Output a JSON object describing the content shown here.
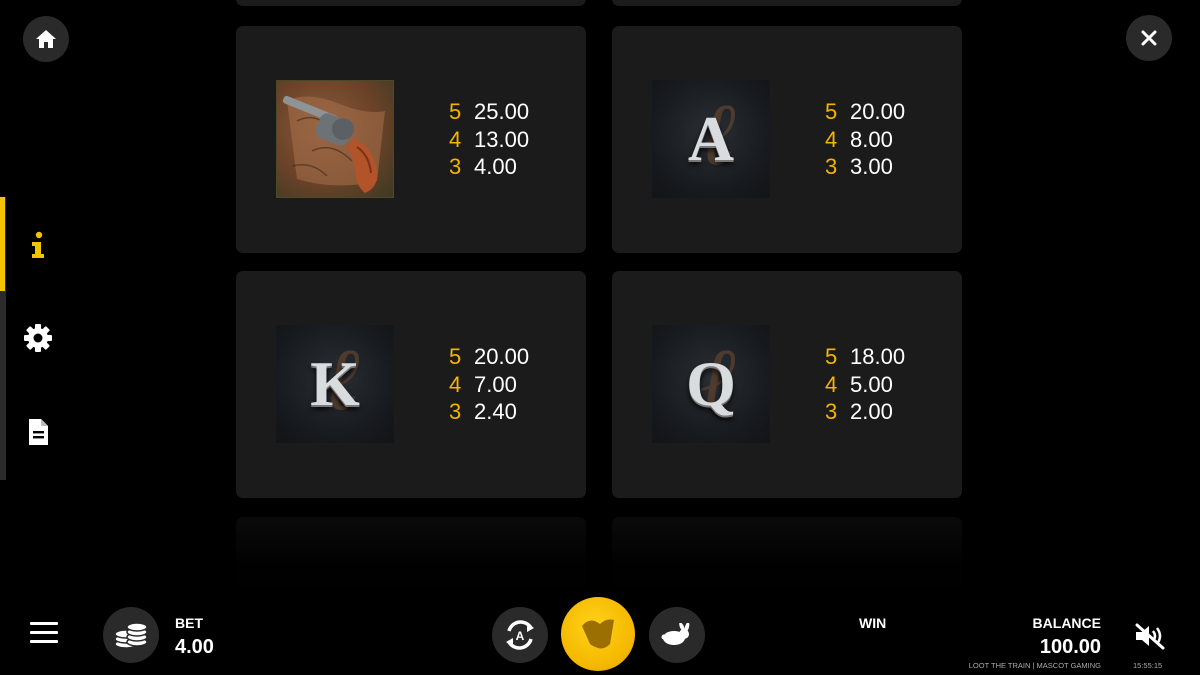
{
  "paytable": {
    "cards": [
      {
        "symbol": "revolver",
        "pays": [
          {
            "count": "5",
            "amount": "25.00"
          },
          {
            "count": "4",
            "amount": "13.00"
          },
          {
            "count": "3",
            "amount": "4.00"
          }
        ]
      },
      {
        "symbol": "A",
        "pays": [
          {
            "count": "5",
            "amount": "20.00"
          },
          {
            "count": "4",
            "amount": "8.00"
          },
          {
            "count": "3",
            "amount": "3.00"
          }
        ]
      },
      {
        "symbol": "K",
        "pays": [
          {
            "count": "5",
            "amount": "20.00"
          },
          {
            "count": "4",
            "amount": "7.00"
          },
          {
            "count": "3",
            "amount": "2.40"
          }
        ]
      },
      {
        "symbol": "Q",
        "pays": [
          {
            "count": "5",
            "amount": "18.00"
          },
          {
            "count": "4",
            "amount": "5.00"
          },
          {
            "count": "3",
            "amount": "2.00"
          }
        ]
      }
    ]
  },
  "side_nav": {
    "items": [
      {
        "icon": "info-icon",
        "active": true
      },
      {
        "icon": "gear-icon",
        "active": false
      },
      {
        "icon": "document-icon",
        "active": false
      }
    ]
  },
  "bottom_bar": {
    "bet_label": "BET",
    "bet_value": "4.00",
    "win_label": "WIN",
    "balance_label": "BALANCE",
    "balance_value": "100.00",
    "brand": "LOOT THE TRAIN | MASCOT GAMING",
    "clock": "15:55:15"
  },
  "colors": {
    "accent": "#f5c400",
    "count_text": "#f5b400",
    "card_bg": "#1b1b1b",
    "button_bg": "#2a2a2a"
  }
}
